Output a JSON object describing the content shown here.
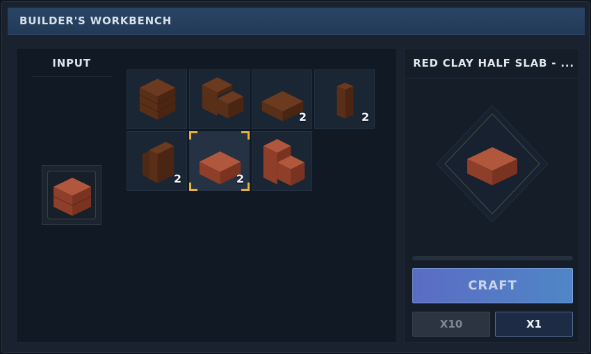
{
  "window": {
    "title": "BUILDER'S WORKBENCH"
  },
  "input": {
    "label": "INPUT",
    "item_icon": "red-clay-block-icon"
  },
  "outputs": [
    {
      "icon": "brick-block-icon",
      "count": "",
      "color": "#6b3a1f"
    },
    {
      "icon": "brick-stairs-icon",
      "count": "",
      "color": "#6b3a1f"
    },
    {
      "icon": "brick-slab-icon",
      "count": "2",
      "color": "#6b3a1f"
    },
    {
      "icon": "brick-pillar-icon",
      "count": "2",
      "color": "#6b3a1f"
    },
    {
      "icon": "brick-wall-icon",
      "count": "2",
      "color": "#6b3a1f"
    },
    {
      "icon": "red-clay-half-slab-icon",
      "count": "2",
      "color": "#8a3a26",
      "selected": true
    },
    {
      "icon": "red-clay-stairs-icon",
      "count": "",
      "color": "#8a3a26"
    }
  ],
  "recipe": {
    "title": "RED CLAY HALF SLAB - ...",
    "preview_icon": "red-clay-half-slab-icon",
    "progress": 0
  },
  "buttons": {
    "craft": "CRAFT",
    "x10": "X10",
    "x1": "X1"
  },
  "colors": {
    "accent": "#5b6cc4",
    "selection": "#e7b23a",
    "titlebar": "#223a57"
  }
}
